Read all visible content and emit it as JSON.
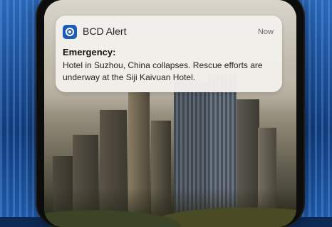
{
  "notification": {
    "app_name": "BCD Alert",
    "time": "Now",
    "title": "Emergency:",
    "body": "Hotel in Suzhou, China collapses. Rescue efforts are underway at the Siji Kaivuan Hotel.",
    "icon": "bcd-alert-app-icon",
    "icon_color": "#1f5bb8"
  }
}
